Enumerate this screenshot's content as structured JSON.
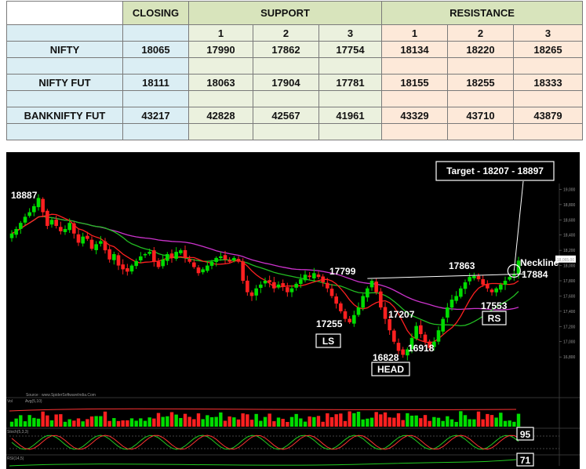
{
  "table": {
    "headers": {
      "closing": "CLOSING",
      "support": "SUPPORT",
      "resistance": "RESISTANCE"
    },
    "levels": [
      "1",
      "2",
      "3",
      "1",
      "2",
      "3"
    ],
    "rows": [
      {
        "name": "NIFTY",
        "closing": "18065",
        "support": [
          "17990",
          "17862",
          "17754"
        ],
        "resistance": [
          "18134",
          "18220",
          "18265"
        ]
      },
      {
        "name": "NIFTY FUT",
        "closing": "18111",
        "support": [
          "18063",
          "17904",
          "17781"
        ],
        "resistance": [
          "18155",
          "18255",
          "18333"
        ]
      },
      {
        "name": "BANKNIFTY FUT",
        "closing": "43217",
        "support": [
          "42828",
          "42567",
          "41961"
        ],
        "resistance": [
          "43329",
          "43710",
          "43879"
        ]
      }
    ]
  },
  "chart_data": {
    "type": "candlestick",
    "title": "",
    "xlabel": "",
    "ylabel": "",
    "ylim": [
      16400,
      19200
    ],
    "y_ticks": [
      "19,000",
      "18,800",
      "18,600",
      "18,400",
      "18,200",
      "18,000",
      "17,800",
      "17,600",
      "17,400",
      "17,200",
      "17,000",
      "16,800"
    ],
    "source_text": "Source : www.SpiderSoftwareIndia.Com",
    "closes": [
      18420,
      18480,
      18560,
      18640,
      18700,
      18780,
      18887,
      18700,
      18520,
      18600,
      18520,
      18450,
      18480,
      18560,
      18420,
      18300,
      18380,
      18350,
      18220,
      18280,
      18320,
      18200,
      18080,
      18150,
      18000,
      17950,
      17920,
      18000,
      18060,
      18120,
      18150,
      18180,
      18050,
      17980,
      18080,
      18150,
      18100,
      18180,
      18200,
      18100,
      18050,
      17980,
      17900,
      17950,
      18000,
      18050,
      18100,
      18120,
      18080,
      18050,
      18100,
      18050,
      17800,
      17650,
      17600,
      17700,
      17750,
      17800,
      17780,
      17700,
      17750,
      17720,
      17650,
      17700,
      17760,
      17820,
      17880,
      17850,
      17900,
      17850,
      17780,
      17700,
      17600,
      17500,
      17400,
      17300,
      17255,
      17350,
      17450,
      17600,
      17700,
      17799,
      17650,
      17450,
      17300,
      17150,
      17000,
      16880,
      16828,
      16900,
      17050,
      17207,
      17100,
      17000,
      16918,
      17000,
      17150,
      17300,
      17450,
      17553,
      17600,
      17700,
      17780,
      17850,
      17863,
      17820,
      17750,
      17700,
      17650,
      17700,
      17750,
      17800,
      17850,
      17884,
      18065
    ],
    "annotations": [
      {
        "text": "18887",
        "value": 18887
      },
      {
        "text": "17799",
        "value": 17799
      },
      {
        "text": "17255",
        "value": 17255
      },
      {
        "text": "17207",
        "value": 17207
      },
      {
        "text": "16918",
        "value": 16918
      },
      {
        "text": "16828",
        "value": 16828
      },
      {
        "text": "17863",
        "value": 17863
      },
      {
        "text": "17553",
        "value": 17553
      },
      {
        "text": "17884",
        "value": 17884
      }
    ],
    "pattern_labels": {
      "left_shoulder": "LS",
      "head": "HEAD",
      "right_shoulder": "RS",
      "neckline": "Neckline"
    },
    "target_text": "Target - 18207 - 18897",
    "last_price_tag": "18,065.00",
    "indicators": {
      "volume": {
        "label": "Vol",
        "avg_label": "Avg(5,10)"
      },
      "stochastic": {
        "label": "Stoch(5,3,3)",
        "value": "95"
      },
      "rsi": {
        "label": "RSI(14,5)",
        "value": "71"
      }
    },
    "colors": {
      "up": "#00dd00",
      "down": "#ff2020",
      "ma_fast": "#ff2020",
      "ma_mid": "#22bb22",
      "ma_slow": "#cc33cc",
      "neckline": "#ffffff"
    }
  }
}
